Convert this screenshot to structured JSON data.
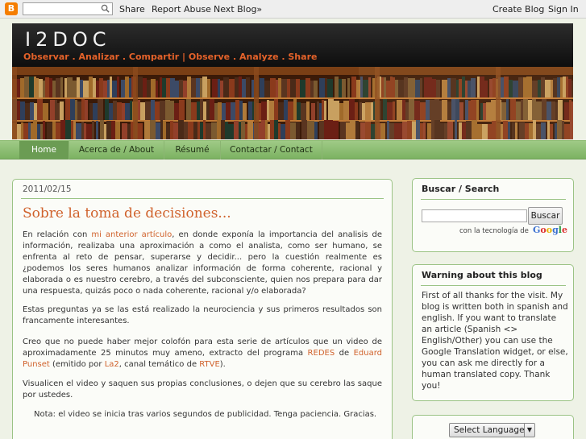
{
  "navbar": {
    "logo_letter": "B",
    "share": "Share",
    "report_abuse": "Report Abuse",
    "next_blog": "Next Blog»",
    "create_blog": "Create Blog",
    "sign_in": "Sign In"
  },
  "header": {
    "title": "I2DOC",
    "subtitle": "Observar . Analizar . Compartir  |  Observe . Analyze . Share"
  },
  "tabs": [
    {
      "label": "Home",
      "active": true
    },
    {
      "label": "Acerca de / About",
      "active": false
    },
    {
      "label": "Résumé",
      "active": false
    },
    {
      "label": "Contactar / Contact",
      "active": false
    }
  ],
  "post": {
    "date": "2011/02/15",
    "title": "Sobre la toma de decisiones...",
    "p1_a": "En relación con ",
    "p1_link": "mi anterior artículo",
    "p1_b": ", en donde exponía la importancia del analisis de información, realizaba una aproximación a como el analista, como ser humano, se enfrenta al reto de pensar, superarse y decidir... pero la cuestión realmente es ¿podemos los seres humanos analizar información de forma coherente, racional y elaborada o es nuestro cerebro, a través del subconsciente, quien nos prepara para dar una respuesta, quizás poco o nada coherente, racional y/o elaborada?",
    "p2": "Estas preguntas ya se las está realizado la neurociencia y sus primeros resultados son francamente interesantes.",
    "p3_a": "Creo que no puede haber mejor colofón para esta serie de artículos que un video de aproximadamente 25 minutos muy ameno, extracto del programa ",
    "p3_link1": "REDES",
    "p3_b": "  de ",
    "p3_link2": "Eduard Punset",
    "p3_c": " (emitido por ",
    "p3_link3": "La2",
    "p3_d": ", canal temático de ",
    "p3_link4": "RTVE",
    "p3_e": ").",
    "p4": "Visualicen el video y saquen sus propias conclusiones, o dejen que su cerebro las saque por ustedes.",
    "note": "Nota: el video se inicia tras varios segundos de publicidad. Tenga paciencia. Gracias."
  },
  "search_widget": {
    "title": "Buscar / Search",
    "button": "Buscar",
    "powered": "con la tecnología de",
    "google": [
      "G",
      "o",
      "o",
      "g",
      "l",
      "e"
    ]
  },
  "warning_widget": {
    "title": "Warning about this blog",
    "text": "First of all thanks for the visit. My blog is written both in spanish and english. If you want to translate an article (Spanish <> English/Other) you can use the Google Translation widget, or else, you can ask me directly for a human translated copy. Thank you!"
  },
  "language_widget": {
    "selected": "Select Language"
  },
  "colors": {
    "accent": "#d0622c",
    "tab_bar": "#8fbf74",
    "border": "#9bc385"
  }
}
